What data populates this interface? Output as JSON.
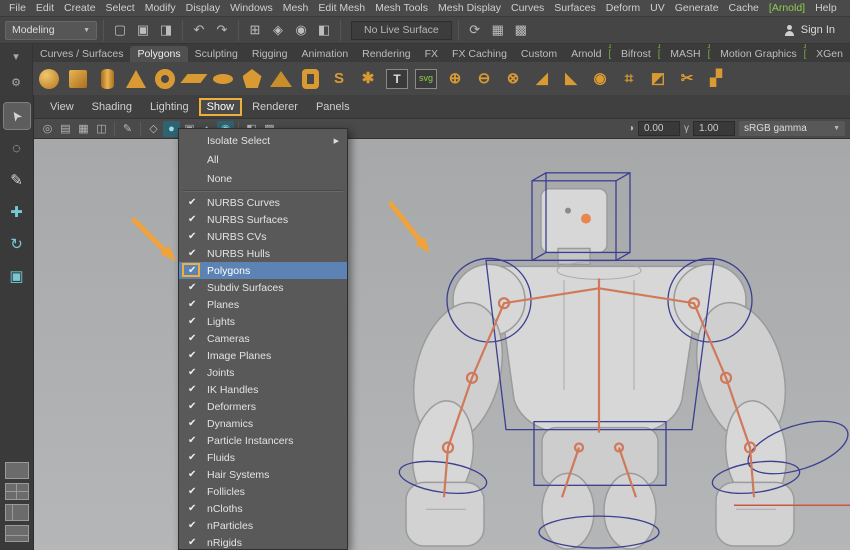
{
  "menubar": {
    "items": [
      "File",
      "Edit",
      "Create",
      "Select",
      "Modify",
      "Display",
      "Windows",
      "Mesh",
      "Edit Mesh",
      "Mesh Tools",
      "Mesh Display",
      "Curves",
      "Surfaces",
      "Deform",
      "UV",
      "Generate",
      "Cache",
      "[Arnold]",
      "Help"
    ]
  },
  "toolbar": {
    "menuset": "Modeling",
    "no_live_surface": "No Live Surface",
    "sign_in": "Sign In"
  },
  "shelf": {
    "tabs": [
      "Curves / Surfaces",
      "Polygons",
      "Sculpting",
      "Rigging",
      "Animation",
      "Rendering",
      "FX",
      "FX Caching",
      "Custom",
      "Arnold",
      "Bifrost",
      "MASH",
      "Motion Graphics",
      "XGen"
    ],
    "active_tab": "Polygons",
    "icon_names": [
      "poly-sphere",
      "poly-cube",
      "poly-cylinder",
      "poly-cone",
      "poly-torus",
      "poly-plane",
      "poly-disc",
      "poly-platonic",
      "poly-pyramid",
      "poly-pipe",
      "poly-helix",
      "poly-gear",
      "type-text",
      "svg-tool",
      "boolean-union",
      "boolean-difference",
      "boolean-intersect",
      "combine",
      "separate",
      "smooth",
      "extrude",
      "bevel",
      "multi-cut",
      "quad-draw"
    ],
    "glyphs": {
      "helix": "S",
      "gear": "✱",
      "text": "T",
      "svg": "svg",
      "union": "⊕",
      "difference": "⊖",
      "intersect": "⊗",
      "combine": "◢",
      "separate": "◣",
      "smooth": "◉",
      "extrude": "⌗",
      "bevel": "◩",
      "multicut": "✂",
      "quaddraw": "▞",
      "bracket": "]["
    }
  },
  "panel_menu": {
    "items": [
      "View",
      "Shading",
      "Lighting",
      "Show",
      "Renderer",
      "Panels"
    ],
    "highlighted": "Show"
  },
  "viewport_toolbar": {
    "exposure": "0.00",
    "gamma": "1.00",
    "colorspace": "sRGB gamma",
    "exposure_icon": "◑",
    "gamma_icon": "γ"
  },
  "show_menu": {
    "items_top": [
      "Isolate Select",
      "All",
      "None"
    ],
    "items_checked": [
      "NURBS Curves",
      "NURBS Surfaces",
      "NURBS CVs",
      "NURBS Hulls",
      "Polygons",
      "Subdiv Surfaces",
      "Planes",
      "Lights",
      "Cameras",
      "Image Planes",
      "Joints",
      "IK Handles",
      "Deformers",
      "Dynamics",
      "Particle Instancers",
      "Fluids",
      "Hair Systems",
      "Follicles",
      "nCloths",
      "nParticles",
      "nRigids"
    ],
    "highlighted": "Polygons"
  },
  "icons": {
    "check": "✔",
    "submenu_arrow": "▶",
    "dropdown_arrow": "▼",
    "shelf_menu": "▾",
    "shelf_gear": "⚙",
    "toolbar_glyphs": [
      "▢",
      "▣",
      "◨",
      "↶",
      "↷",
      "⊞",
      "◈",
      "◉",
      "◧",
      "⟳",
      "▦",
      "▩"
    ],
    "vp_glyphs": [
      "◎",
      "▤",
      "▦",
      "◫",
      "✎",
      "◇",
      "●",
      "▣",
      "◐",
      "◉",
      "◧",
      "▩"
    ],
    "tool_glyphs": [
      "➤",
      "◌",
      "✎",
      "✚",
      "↻",
      "▣"
    ]
  },
  "colors": {
    "highlight_blue": "#5c83b4",
    "annotation_yellow": "#edb13a",
    "shelf_orange": "#d99a33",
    "arnold_green": "#8ed04c"
  }
}
